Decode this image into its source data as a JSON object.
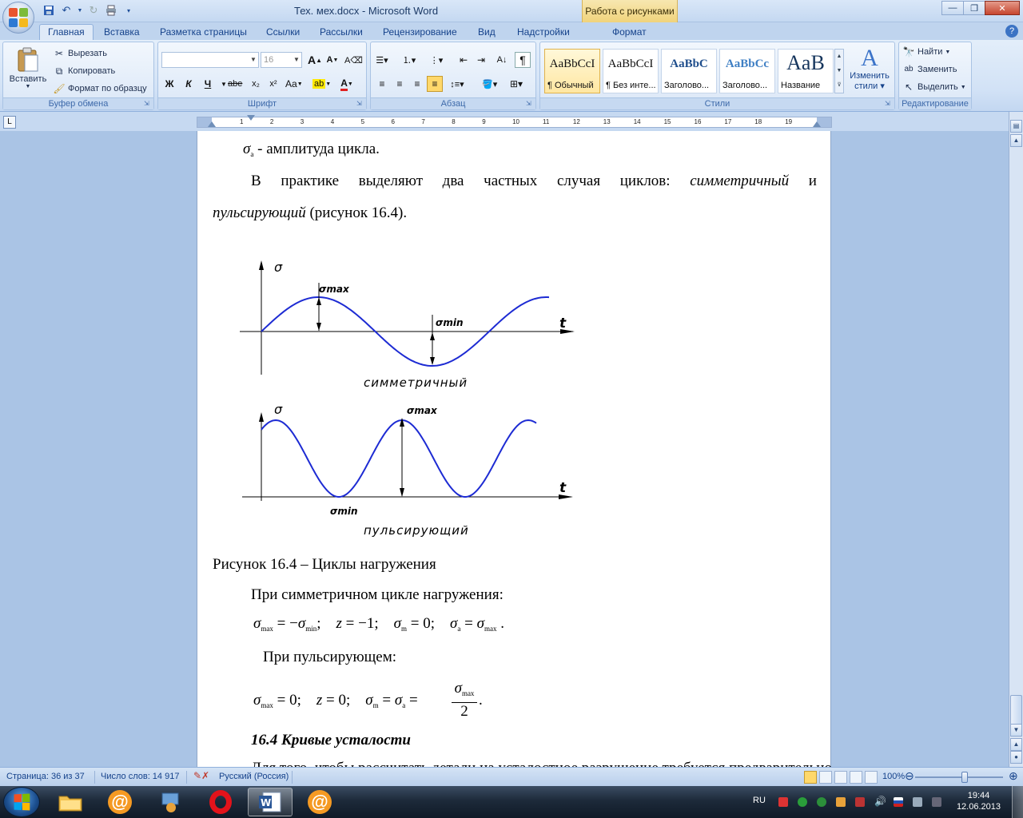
{
  "window": {
    "title": "Тех. мех.docx - Microsoft Word",
    "context_tab_group": "Работа с рисунками"
  },
  "tabs": [
    "Главная",
    "Вставка",
    "Разметка страницы",
    "Ссылки",
    "Рассылки",
    "Рецензирование",
    "Вид",
    "Надстройки",
    "Формат"
  ],
  "ribbon": {
    "clipboard": {
      "label": "Буфер обмена",
      "paste": "Вставить",
      "cut": "Вырезать",
      "copy": "Копировать",
      "format_painter": "Формат по образцу"
    },
    "font": {
      "label": "Шрифт",
      "font_name": "",
      "font_size": "16",
      "bold": "Ж",
      "italic": "К",
      "underline": "Ч",
      "strike": "abe",
      "subscript": "x₂",
      "superscript": "x²",
      "change_case": "Aa",
      "grow": "A",
      "shrink": "A"
    },
    "paragraph": {
      "label": "Абзац"
    },
    "styles": {
      "label": "Стили",
      "items": [
        {
          "sample": "AaBbCcI",
          "name": "¶ Обычный"
        },
        {
          "sample": "AaBbCcI",
          "name": "¶ Без инте..."
        },
        {
          "sample": "AaBbC",
          "name": "Заголово..."
        },
        {
          "sample": "AaBbCc",
          "name": "Заголово..."
        },
        {
          "sample": "AaB",
          "name": "Название"
        }
      ],
      "change_styles_line1": "Изменить",
      "change_styles_line2": "стили"
    },
    "editing": {
      "label": "Редактирование",
      "find": "Найти",
      "replace": "Заменить",
      "select": "Выделить"
    }
  },
  "ruler": {
    "numbers": [
      "1",
      "2",
      "3",
      "4",
      "5",
      "6",
      "7",
      "8",
      "9",
      "10",
      "11",
      "12",
      "13",
      "14",
      "15",
      "16",
      "17",
      "18",
      "19"
    ]
  },
  "document": {
    "line1_suffix": "- амплитуда цикла.",
    "para2_words": [
      "В",
      "практике",
      "выделяют",
      "два",
      "частных",
      "случая",
      "циклов:",
      "симметричный",
      "и"
    ],
    "para2_line2_italic": "пульсирующий",
    "para2_line2_rest": " (рисунок 16.4).",
    "caption": "Рисунок 16.4 – Циклы нагружения",
    "sym_intro": "При симметричном цикле нагружения:",
    "puls_intro": "При пульсирующем:",
    "heading": "16.4 Кривые усталости",
    "cut_line": "Для того, чтобы рассчитать детали на усталостное разрушение требуется предварительно"
  },
  "figure": {
    "sigma": "σ",
    "sigma_max": "σmax",
    "sigma_min": "σmin",
    "t": "t",
    "caption_sym": "симметричный",
    "caption_puls": "пульсирующий"
  },
  "statusbar": {
    "page": "Страница: 36 из 37",
    "words": "Число слов: 14 917",
    "language": "Русский (Россия)",
    "zoom": "100%"
  },
  "taskbar": {
    "lang": "RU",
    "time": "19:44",
    "date": "12.06.2013"
  }
}
